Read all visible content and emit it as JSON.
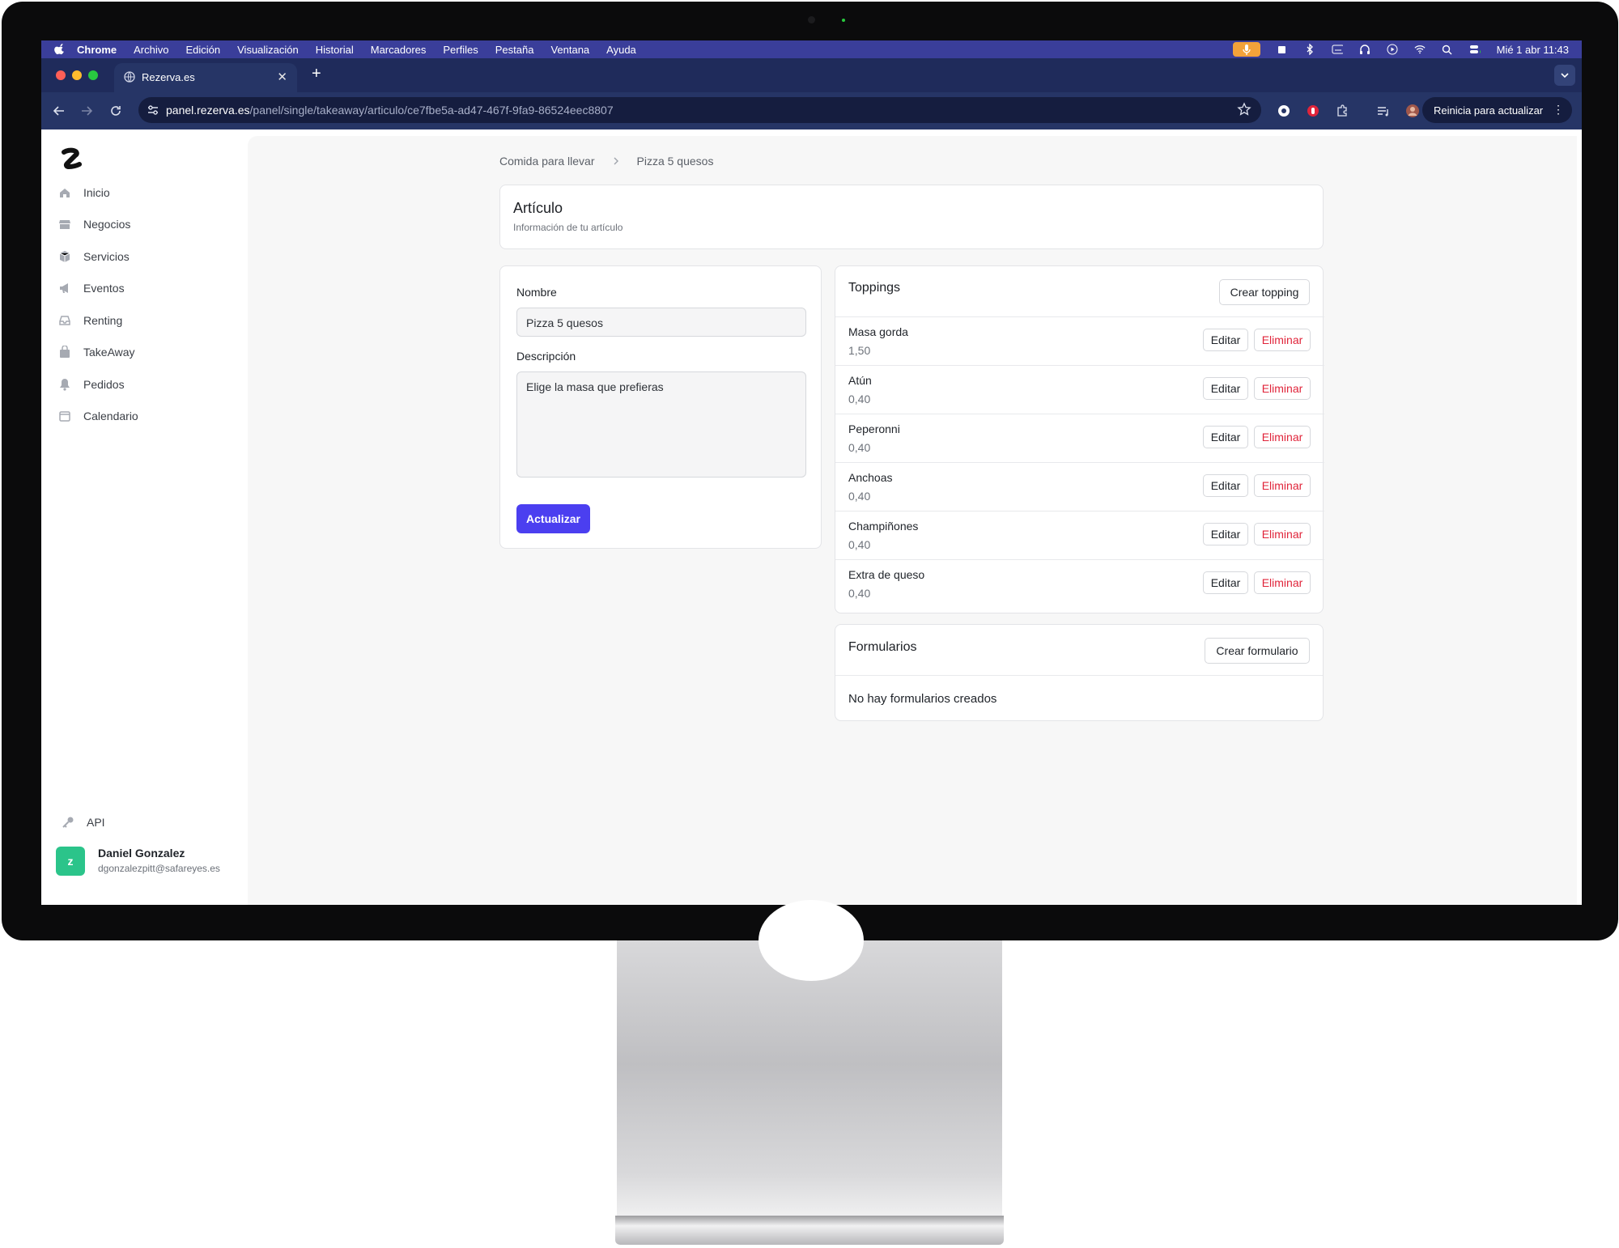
{
  "menubar": {
    "app": "Chrome",
    "items": [
      "Archivo",
      "Edición",
      "Visualización",
      "Historial",
      "Marcadores",
      "Perfiles",
      "Pestaña",
      "Ventana",
      "Ayuda"
    ],
    "clock": "Mié 1 abr 11:43",
    "mic_color": "#f3a23a"
  },
  "browser": {
    "tab_title": "Rezerva.es",
    "url_host": "panel.rezerva.es",
    "url_path": "/panel/single/takeaway/articulo/ce7fbe5a-ad47-467f-9fa9-86524eec8807",
    "relaunch_label": "Reinicia para actualizar"
  },
  "sidebar": {
    "items": [
      {
        "label": "Inicio",
        "icon": "home-icon"
      },
      {
        "label": "Negocios",
        "icon": "store-icon"
      },
      {
        "label": "Servicios",
        "icon": "box-icon"
      },
      {
        "label": "Eventos",
        "icon": "megaphone-icon"
      },
      {
        "label": "Renting",
        "icon": "inbox-icon"
      },
      {
        "label": "TakeAway",
        "icon": "bag-icon"
      },
      {
        "label": "Pedidos",
        "icon": "bell-icon"
      },
      {
        "label": "Calendario",
        "icon": "calendar-icon"
      }
    ],
    "api_label": "API",
    "user": {
      "avatar": "z",
      "name": "Daniel Gonzalez",
      "email": "dgonzalezpitt@safareyes.es"
    }
  },
  "breadcrumb": {
    "parent": "Comida para llevar",
    "current": "Pizza 5 quesos"
  },
  "article": {
    "title": "Artículo",
    "subtitle": "Información de tu artículo"
  },
  "form": {
    "name_label": "Nombre",
    "name_value": "Pizza 5 quesos",
    "description_label": "Descripción",
    "description_value": "Elige la masa que prefieras",
    "submit_label": "Actualizar"
  },
  "toppings": {
    "title": "Toppings",
    "create_label": "Crear topping",
    "edit_label": "Editar",
    "delete_label": "Eliminar",
    "items": [
      {
        "name": "Masa gorda",
        "price": "1,50"
      },
      {
        "name": "Atún",
        "price": "0,40"
      },
      {
        "name": "Peperonni",
        "price": "0,40"
      },
      {
        "name": "Anchoas",
        "price": "0,40"
      },
      {
        "name": "Champiñones",
        "price": "0,40"
      },
      {
        "name": "Extra de queso",
        "price": "0,40"
      }
    ]
  },
  "forms": {
    "title": "Formularios",
    "create_label": "Crear formulario",
    "empty_text": "No hay formularios creados"
  },
  "colors": {
    "primary": "#4b3ff0",
    "danger": "#e0243a",
    "avatar": "#2bc48a"
  }
}
